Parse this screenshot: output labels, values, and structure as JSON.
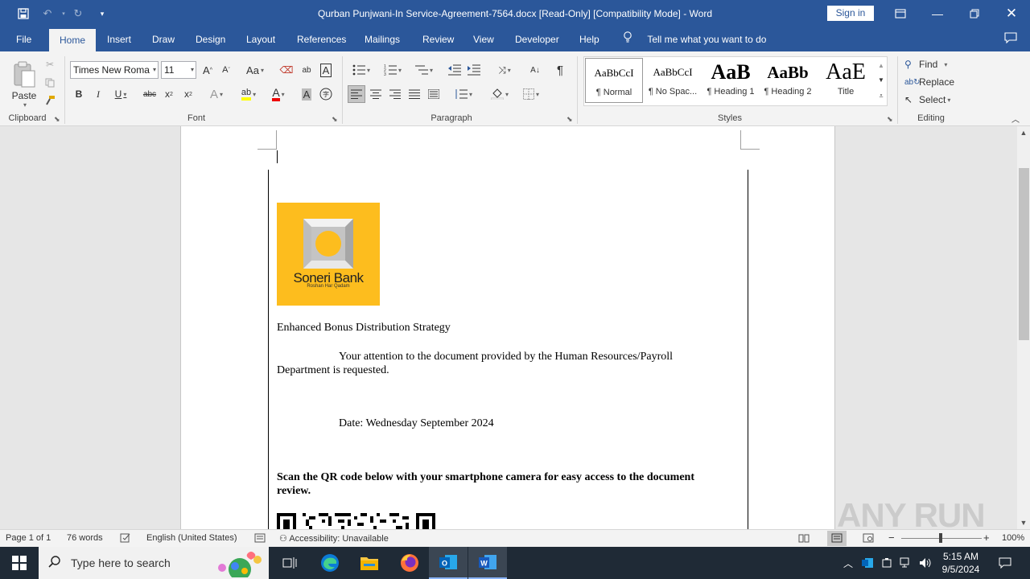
{
  "titlebar": {
    "title": "Qurban Punjwani-In Service-Agreement-7564.docx [Read-Only] [Compatibility Mode]  -  Word",
    "sign_in": "Sign in"
  },
  "tabs": [
    "File",
    "Home",
    "Insert",
    "Draw",
    "Design",
    "Layout",
    "References",
    "Mailings",
    "Review",
    "View",
    "Developer",
    "Help"
  ],
  "active_tab": "Home",
  "tell_me": "Tell me what you want to do",
  "ribbon": {
    "clipboard": {
      "label": "Clipboard",
      "paste": "Paste"
    },
    "font": {
      "label": "Font",
      "name": "Times New Roma",
      "size": "11",
      "aa": "Aa"
    },
    "paragraph": {
      "label": "Paragraph"
    },
    "styles": {
      "label": "Styles",
      "items": [
        {
          "preview": "AaBbCcI",
          "name": "¶ Normal"
        },
        {
          "preview": "AaBbCcI",
          "name": "¶ No Spac..."
        },
        {
          "preview": "AaB",
          "name": "¶ Heading 1"
        },
        {
          "preview": "AaBb",
          "name": "¶ Heading 2"
        },
        {
          "preview": "AaE",
          "name": "Title"
        }
      ]
    },
    "editing": {
      "label": "Editing",
      "find": "Find",
      "replace": "Replace",
      "select": "Select"
    }
  },
  "document": {
    "logo_name": "Soneri Bank",
    "logo_tagline": "Roshan Har Qadam",
    "heading": "Enhanced Bonus Distribution Strategy",
    "para1_line1": "Your attention to the document provided by the Human Resources/Payroll",
    "para1_line2": "Department is requested.",
    "date": "Date: Wednesday September 2024",
    "qr_line1": "Scan the QR code below with your smartphone camera for easy access to the document",
    "qr_line2": "review."
  },
  "watermark": "ANY RUN",
  "status": {
    "page": "Page 1 of 1",
    "words": "76 words",
    "language": "English (United States)",
    "accessibility": "Accessibility: Unavailable",
    "zoom": "100%"
  },
  "taskbar": {
    "search_placeholder": "Type here to search",
    "time": "5:15 AM",
    "date": "9/5/2024"
  }
}
